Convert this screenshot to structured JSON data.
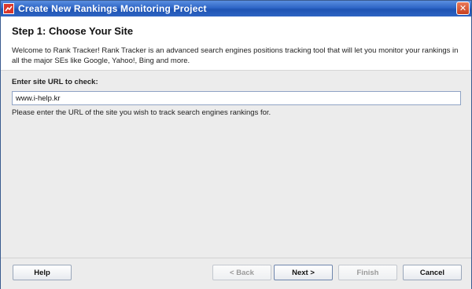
{
  "window": {
    "title": "Create New Rankings Monitoring Project",
    "close_label": "✕"
  },
  "header": {
    "step_title": "Step 1: Choose Your Site",
    "description": "Welcome to Rank Tracker! Rank Tracker is an advanced search engines positions tracking tool that will let you monitor your rankings in all the major SEs like Google, Yahoo!, Bing and more."
  },
  "form": {
    "url_label": "Enter site URL to check:",
    "url_value": "www.i-help.kr",
    "hint": "Please enter the URL of the site you wish to track search engines rankings for."
  },
  "buttons": {
    "help": "Help",
    "back": "< Back",
    "next": "Next >",
    "finish": "Finish",
    "cancel": "Cancel"
  }
}
